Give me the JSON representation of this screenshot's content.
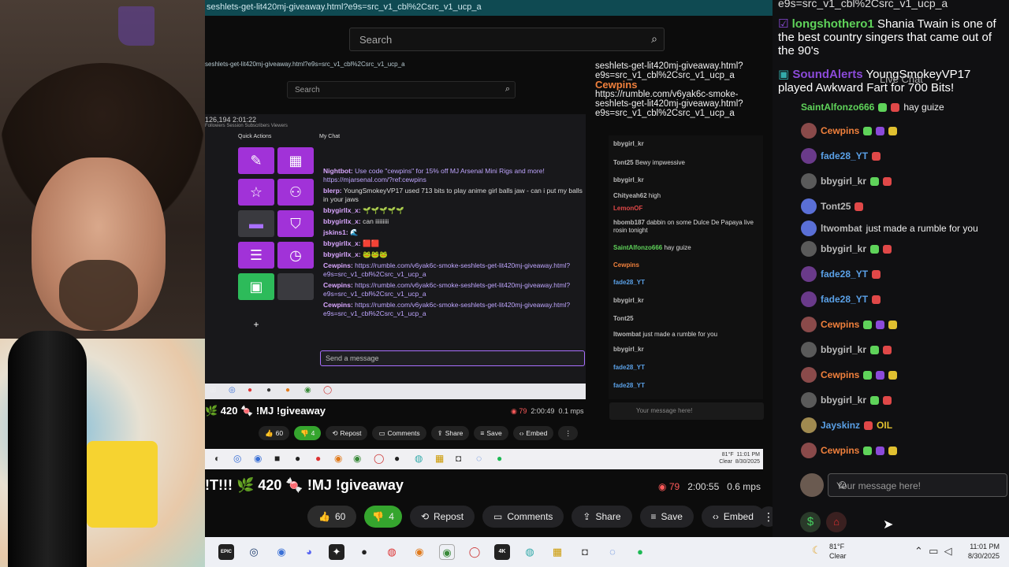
{
  "stream": {
    "url_fragment": "seshlets-get-lit420mj-giveaway.html?e9s=src_v1_cbl%2Csrc_v1_ucp_a",
    "search_placeholder": "Search",
    "title": "!T!!! 🌿 420 🍬 !MJ !giveaway",
    "viewers": "79",
    "uptime": "2:00:55",
    "bitrate": "0.6 mps",
    "likes": "60",
    "dislikes": "4",
    "buttons": {
      "repost": "Repost",
      "comments": "Comments",
      "share": "Share",
      "save": "Save",
      "embed": "Embed"
    }
  },
  "inner_stream": {
    "url_fragment": "seshlets-get-lit420mj-giveaway.html?e9s=src_v1_cbl%2Csrc_v1_ucp_a",
    "search_placeholder": "Search",
    "title": "🌿 420 🍬 !MJ !giveaway",
    "viewers": "79",
    "uptime": "2:00:49",
    "bitrate": "0.1 mps",
    "likes": "60",
    "dislikes": "4",
    "buttons": {
      "repost": "Repost",
      "comments": "Comments",
      "share": "Share",
      "save": "Save",
      "embed": "Embed"
    },
    "stats": "126,194     2:01:22",
    "stat_labels": "Followers  Session   Subscribers  Viewers",
    "quick_actions": "Quick Actions",
    "my_chat": "My Chat",
    "chat_lines": [
      {
        "user": "Nightbot:",
        "text": "Use code \"cewpins\" for 15% off MJ Arsenal Mini Rigs and more! https://mjarsenal.com/?ref:cewpins"
      },
      {
        "user": "blerp:",
        "text": "YoungSmokeyVP17 used 713 bits to play anime girl balls jaw - can i put my balls in your jaws"
      },
      {
        "user": "bbygirllx_x:",
        "text": "🌱🌱🌱🌱🌱"
      },
      {
        "user": "bbygirllx_x:",
        "text": "can iiiiiiiii"
      },
      {
        "user": "jskins1:",
        "text": "🌊"
      },
      {
        "user": "bbygirllx_x:",
        "text": "🟥🟥"
      },
      {
        "user": "bbygirllx_x:",
        "text": "🐸🐸🐸"
      },
      {
        "user": "Cewpins:",
        "text": "https://rumble.com/v6yak6c-smoke-seshlets-get-lit420mj-giveaway.html?e9s=src_v1_cbl%2Csrc_v1_ucp_a"
      },
      {
        "user": "Cewpins:",
        "text": "https://rumble.com/v6yak6c-smoke-seshlets-get-lit420mj-giveaway.html?e9s=src_v1_cbl%2Csrc_v1_ucp_a"
      },
      {
        "user": "Cewpins:",
        "text": "https://rumble.com/v6yak6c-smoke-seshlets-get-lit420mj-giveaway.html?e9s=src_v1_cbl%2Csrc_v1_ucp_a"
      }
    ],
    "send_placeholder": "Send a message",
    "chat_url_lines": "seshlets-get-lit420mj-giveaway.html?e9s=src_v1_cbl%2Csrc_v1_ucp_a",
    "chat_cewpins": "Cewpins",
    "chat_cewpins_link": "https://rumble.com/v6yak6c-smoke-seshlets-get-lit420mj-giveaway.html?e9s=src_v1_cbl%2Csrc_v1_ucp_a",
    "chat_rows": [
      {
        "user": "bbygirl_kr",
        "msg": ""
      },
      {
        "user": "Tont25",
        "msg": "Bewy impwessive"
      },
      {
        "user": "bbygirl_kr",
        "msg": ""
      },
      {
        "user": "Chityeah62",
        "msg": "high"
      },
      {
        "user": "LemonOF",
        "msg": ""
      },
      {
        "user": "hbomb187",
        "msg": "dabbin on some Dulce De Papaya live rosin tonight"
      },
      {
        "user": "SaintAlfonzo666",
        "msg": "hay guize"
      },
      {
        "user": "Cewpins",
        "msg": ""
      },
      {
        "user": "fade28_YT",
        "msg": ""
      },
      {
        "user": "bbygirl_kr",
        "msg": ""
      },
      {
        "user": "Tont25",
        "msg": ""
      },
      {
        "user": "ltwombat",
        "msg": "just made a rumble for you"
      },
      {
        "user": "bbygirl_kr",
        "msg": ""
      },
      {
        "user": "fade28_YT",
        "msg": ""
      },
      {
        "user": "fade28_YT",
        "msg": ""
      }
    ],
    "chat_input_placeholder": "Your message here!",
    "weather_temp": "81°F",
    "weather_cond": "Clear",
    "clock_time": "11:01 PM",
    "clock_date": "8/30/2025"
  },
  "chat": {
    "overlay": [
      {
        "user": "longshothero1",
        "text": "Shania Twain is one of the best country singers that came out of the 90's",
        "color": "#5fd35a"
      },
      {
        "user": "SoundAlerts",
        "text": "YoungSmokeyVP17 played Awkward Fart for 700 Bits!",
        "color": "#8b4ad9"
      }
    ],
    "header_partial": "e9s=src_v1_cbl%2Csrc_v1_ucp_a",
    "live_chat": "Live Chat",
    "rows": [
      {
        "user": "SaintAlfonzo666",
        "msg": "hay guize",
        "color": "#5fd35a"
      },
      {
        "user": "Cewpins",
        "msg": "",
        "color": "#f0803c"
      },
      {
        "user": "fade28_YT",
        "msg": "",
        "color": "#5aa0e6"
      },
      {
        "user": "bbygirl_kr",
        "msg": "",
        "color": "#b9b9b9"
      },
      {
        "user": "Tont25",
        "msg": "",
        "color": "#b9b9b9"
      },
      {
        "user": "ltwombat",
        "msg": "just made a rumble for you",
        "color": "#b9b9b9"
      },
      {
        "user": "bbygirl_kr",
        "msg": "",
        "color": "#b9b9b9"
      },
      {
        "user": "fade28_YT",
        "msg": "",
        "color": "#5aa0e6"
      },
      {
        "user": "fade28_YT",
        "msg": "",
        "color": "#5aa0e6"
      },
      {
        "user": "Cewpins",
        "msg": "",
        "color": "#f0803c"
      },
      {
        "user": "bbygirl_kr",
        "msg": "",
        "color": "#b9b9b9"
      },
      {
        "user": "Cewpins",
        "msg": "",
        "color": "#f0803c"
      },
      {
        "user": "bbygirl_kr",
        "msg": "",
        "color": "#b9b9b9"
      },
      {
        "user": "Jayskinz",
        "msg": "OIL",
        "color": "#5aa0e6"
      },
      {
        "user": "Cewpins",
        "msg": "",
        "color": "#f0803c"
      }
    ],
    "input_placeholder": "Your message here!"
  },
  "taskbar": {
    "weather_temp": "81°F",
    "weather_cond": "Clear",
    "clock_time": "11:01 PM",
    "clock_date": "8/30/2025",
    "icon_labels": {
      "epic": "EPIC",
      "fourk": "4K"
    }
  },
  "colors": {
    "accent": "#a970ff",
    "rumble_green": "#85c742",
    "dislike_green": "#35a52e"
  }
}
